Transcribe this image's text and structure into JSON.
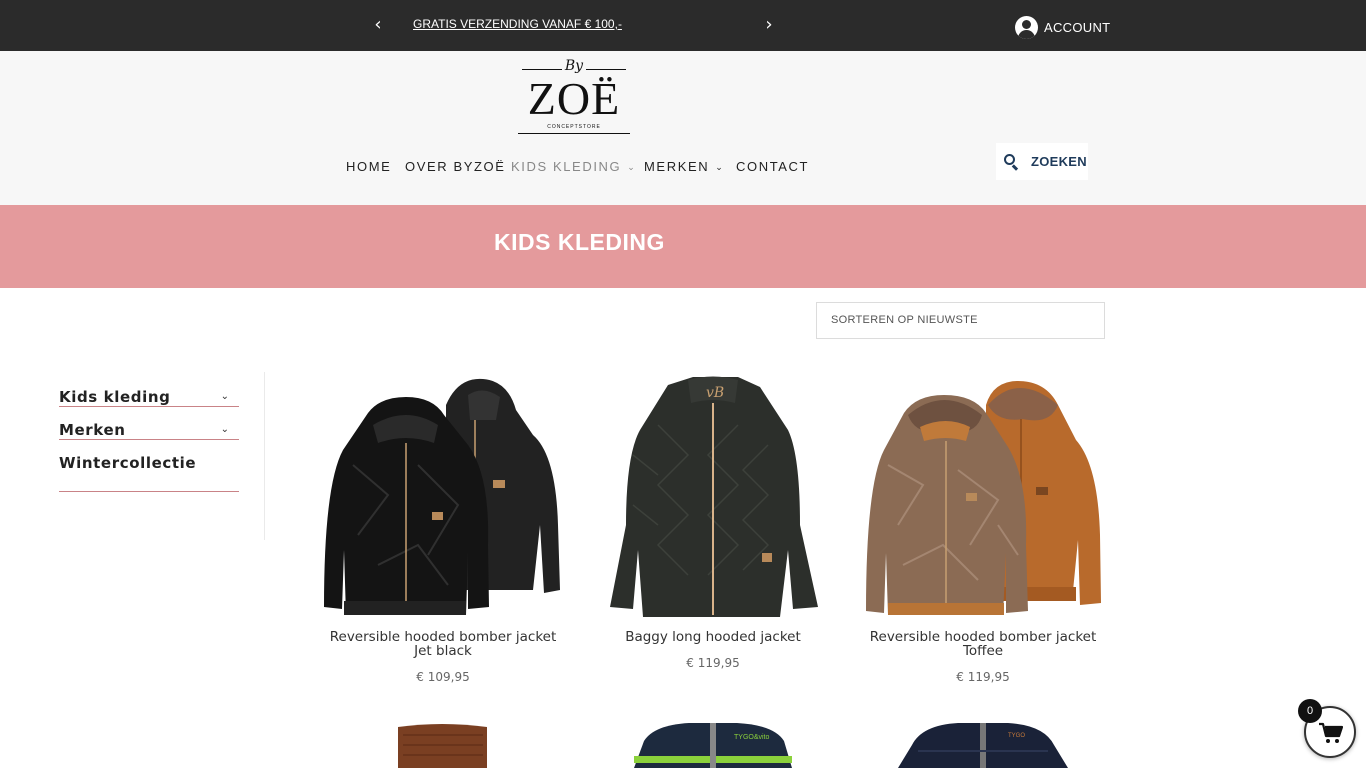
{
  "topbar": {
    "announcement": "GRATIS VERZENDING VANAF € 100,-",
    "prev_icon": "chevron-left-icon",
    "next_icon": "chevron-right-icon",
    "account_label": "ACCOUNT",
    "account_icon": "user-circle-icon"
  },
  "logo": {
    "by": "By",
    "name": "ZOË",
    "subtitle": "CONCEPTSTORE"
  },
  "nav": {
    "items": [
      {
        "label": "HOME",
        "has_dropdown": false
      },
      {
        "label": "OVER BYZOË",
        "has_dropdown": false
      },
      {
        "label": "KIDS KLEDING",
        "has_dropdown": true,
        "active": true
      },
      {
        "label": "MERKEN",
        "has_dropdown": true
      },
      {
        "label": "CONTACT",
        "has_dropdown": false
      }
    ]
  },
  "search": {
    "label": "ZOEKEN",
    "icon": "search-icon"
  },
  "banner": {
    "title": "KIDS KLEDING",
    "color": "#e49a9c"
  },
  "sort": {
    "selected": "SORTEREN OP NIEUWSTE"
  },
  "sidebar": {
    "items": [
      {
        "label": "Kids kleding",
        "expandable": true
      },
      {
        "label": "Merken",
        "expandable": true
      },
      {
        "label": "Wintercollectie",
        "expandable": false
      }
    ]
  },
  "products": [
    {
      "name_line1": "Reversible hooded bomber jacket",
      "name_line2": "Jet black",
      "price": "€ 109,95"
    },
    {
      "name_line1": "Baggy long hooded jacket",
      "name_line2": "",
      "price": "€ 119,95"
    },
    {
      "name_line1": "Reversible hooded bomber jacket",
      "name_line2": "Toffee",
      "price": "€ 119,95"
    }
  ],
  "cart": {
    "count": "0",
    "icon": "shopping-cart-icon"
  }
}
